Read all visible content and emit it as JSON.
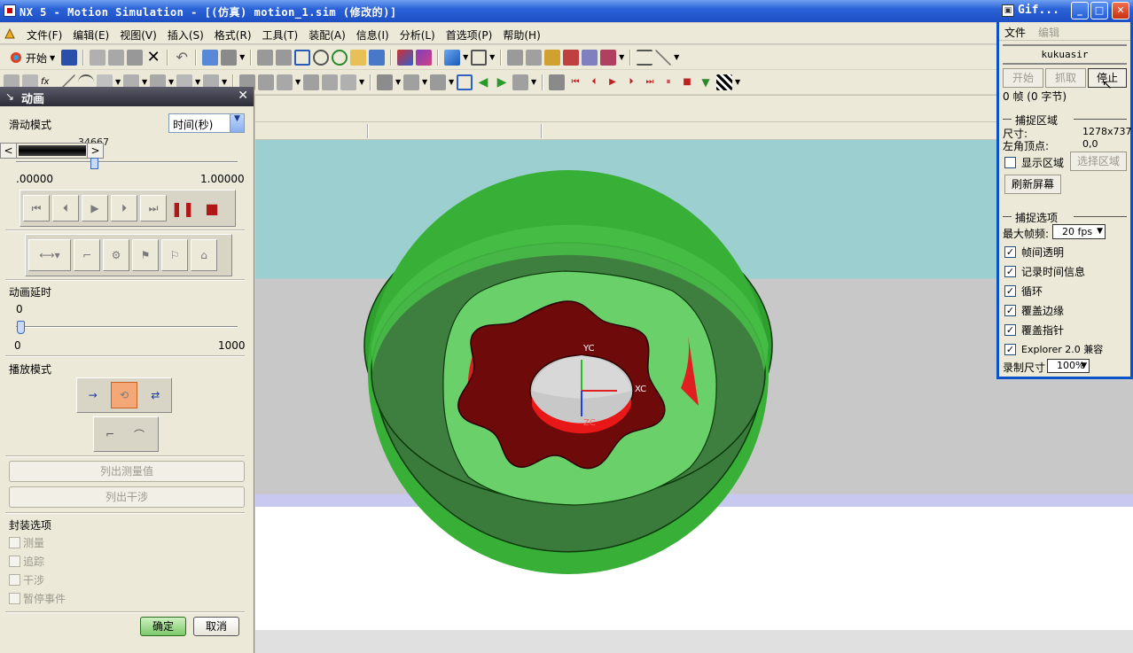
{
  "window": {
    "title": "NX 5 - Motion Simulation - [(仿真) motion_1.sim (修改的)]"
  },
  "menu": {
    "items": [
      "文件(F)",
      "编辑(E)",
      "视图(V)",
      "插入(S)",
      "格式(R)",
      "工具(T)",
      "装配(A)",
      "信息(I)",
      "分析(L)",
      "首选项(P)",
      "帮助(H)"
    ]
  },
  "toolbar": {
    "start_label": "开始"
  },
  "animation_panel": {
    "title": "动画",
    "slide_mode_label": "滑动模式",
    "slide_mode_value": "时间(秒)",
    "slider_value": "34667",
    "range_min": ".00000",
    "range_max": "1.00000",
    "delay_label": "动画延时",
    "delay_value": "0",
    "delay_min": "0",
    "delay_max": "1000",
    "play_mode_label": "播放模式",
    "list_measure_label": "列出测量值",
    "list_interference_label": "列出干涉",
    "package_options_label": "封装选项",
    "package_options": [
      "测量",
      "追踪",
      "干涉",
      "暂停事件"
    ],
    "ok_label": "确定",
    "cancel_label": "取消"
  },
  "viewport": {
    "axis_labels": {
      "yc": "YC",
      "xc": "XC",
      "zc": "ZC"
    }
  },
  "gif_window": {
    "title": "Gif...",
    "menu": [
      "文件",
      "编辑"
    ],
    "user": "kukuasir",
    "start_label": "开始",
    "capture_label": "抓取",
    "stop_label": "停止",
    "frame_info": "0 帧 (0 字节)",
    "capture_area_header": "捕捉区域",
    "size_label": "尺寸:",
    "size_value": "1278x737",
    "topleft_label": "左角顶点:",
    "topleft_value": "0,0",
    "show_area_label": "显示区域",
    "select_area_label": "选择区域",
    "refresh_label": "刷新屏幕",
    "capture_options_header": "捕捉选项",
    "max_fps_label": "最大帧频:",
    "max_fps_value": "20 fps",
    "options": [
      {
        "label": "帧间透明",
        "checked": true
      },
      {
        "label": "记录时间信息",
        "checked": true
      },
      {
        "label": "循环",
        "checked": true
      },
      {
        "label": "覆盖边缘",
        "checked": true
      },
      {
        "label": "覆盖指针",
        "checked": true
      },
      {
        "label": "Explorer 2.0 兼容",
        "checked": true
      }
    ],
    "record_size_label": "录制尺寸",
    "record_size_value": "100%"
  }
}
